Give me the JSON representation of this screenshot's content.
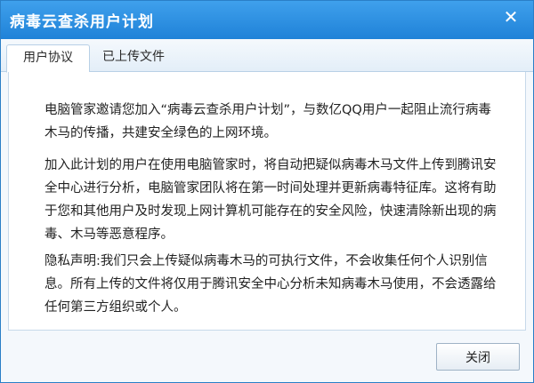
{
  "window": {
    "title": "病毒云查杀用户计划"
  },
  "tabs": [
    {
      "label": "用户协议",
      "active": true
    },
    {
      "label": "已上传文件",
      "active": false
    }
  ],
  "content": {
    "paragraphs": [
      "电脑管家邀请您加入“病毒云查杀用户计划”，与数亿QQ用户一起阻止流行病毒木马的传播，共建安全绿色的上网环境。",
      "加入此计划的用户在使用电脑管家时，将自动把疑似病毒木马文件上传到腾讯安全中心进行分析，电脑管家团队将在第一时间处理并更新病毒特征库。这将有助于您和其他用户及时发现上网计算机可能存在的安全风险，快速清除新出现的病毒、木马等恶意程序。",
      "隐私声明:我们只会上传疑似病毒木马的可执行文件，不会收集任何个人识别信息。所有上传的文件将仅用于腾讯安全中心分析未知病毒木马使用，不会透露给任何第三方组织或个人。"
    ]
  },
  "footer": {
    "close_label": "关闭"
  },
  "icons": {
    "close": "close-icon"
  },
  "colors": {
    "titlebar": "#1f82d8",
    "border": "#2a7fc7"
  }
}
